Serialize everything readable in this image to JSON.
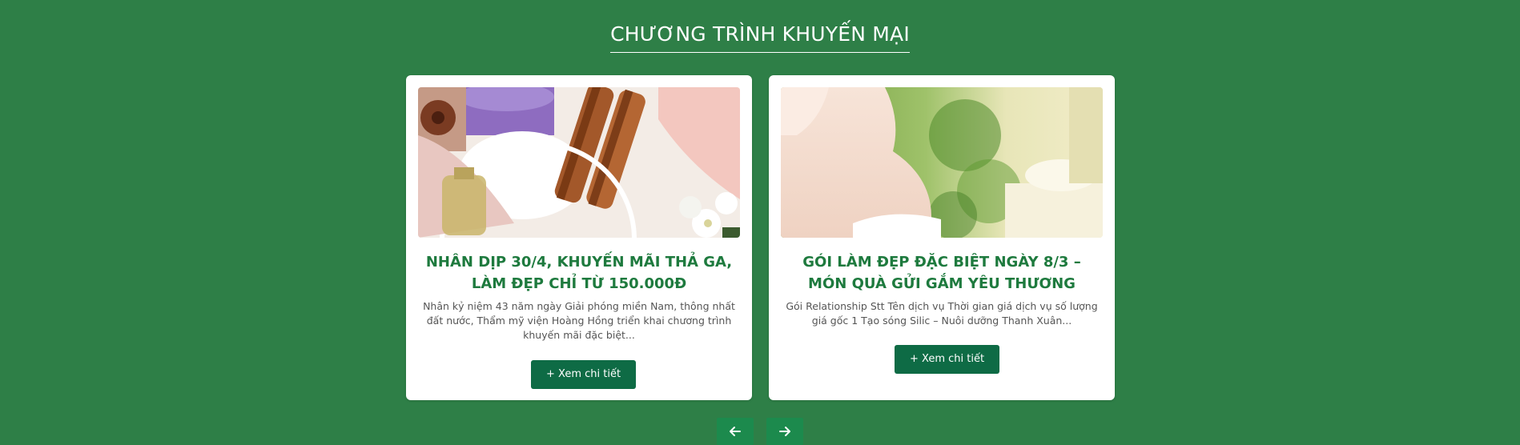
{
  "section": {
    "title": "CHƯƠNG TRÌNH KHUYẾN MẠI"
  },
  "colors": {
    "background": "#2e7f47",
    "title_green": "#1e7a3e",
    "button": "#0e6b45",
    "nav_button": "#1c8a4d"
  },
  "promotions": [
    {
      "title": "NHÂN DỊP 30/4, KHUYẾN MÃI THẢ GA, LÀM ĐẸP CHỈ TỪ 150.000Đ",
      "description": "Nhân kỷ niệm 43 năm ngày Giải phóng miền Nam, thông nhất đất nước, Thẩm mỹ viện Hoàng Hồng triển khai chương trình khuyến mãi đặc biệt...",
      "button_label": "+ Xem chi tiết"
    },
    {
      "title": "GÓI LÀM ĐẸP ĐẶC BIỆT NGÀY 8/3 – MÓN QUÀ GỬI GẮM YÊU THƯƠNG",
      "description": "Gói Relationship Stt Tên dịch vụ Thời gian giá dịch vụ số lượng giá gốc 1 Tạo sóng Silic – Nuôi dưỡng Thanh Xuân...",
      "button_label": "+ Xem chi tiết"
    }
  ],
  "carousel": {
    "prev_icon": "arrow-left-icon",
    "next_icon": "arrow-right-icon"
  }
}
